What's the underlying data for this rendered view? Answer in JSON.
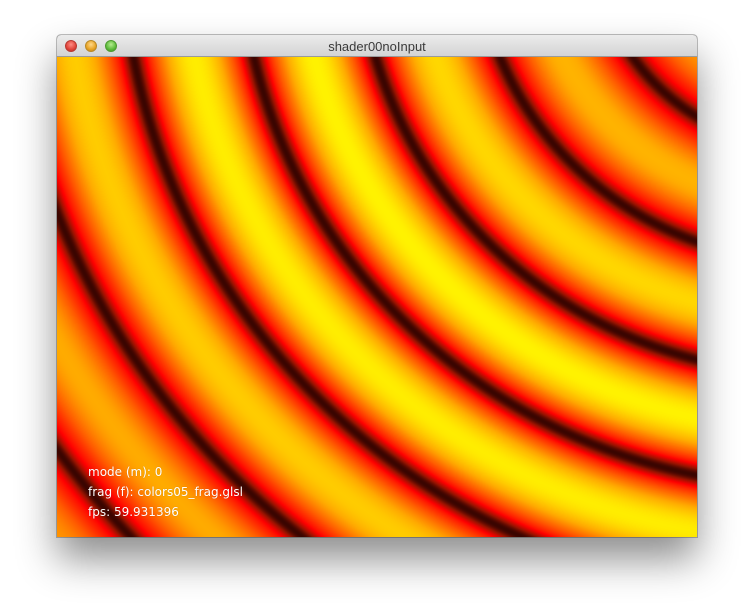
{
  "window": {
    "title": "shader00noInput"
  },
  "overlay": {
    "mode": "mode (m): 0",
    "frag": "frag (f): colors05_frag.glsl",
    "fps": "fps: 59.931396"
  },
  "colors": {
    "dark": "#200000",
    "red": "#ff0000",
    "orange": "#ff7a00",
    "yellow": "#fff200"
  },
  "icons": [
    "close-button-icon",
    "minimize-button-icon",
    "zoom-button-icon"
  ]
}
